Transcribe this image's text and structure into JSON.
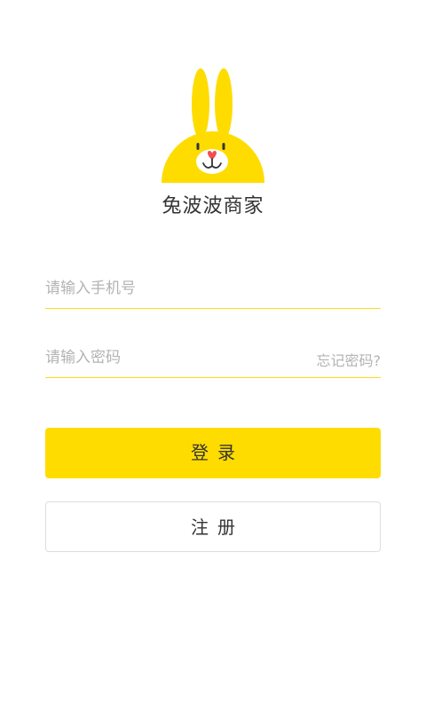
{
  "brand": {
    "app_name": "兔波波商家",
    "accent_color": "#FFDC00",
    "logo_icon": "rabbit-logo-icon"
  },
  "form": {
    "phone_placeholder": "请输入手机号",
    "phone_value": "",
    "password_placeholder": "请输入密码",
    "password_value": "",
    "forgot_password_label": "忘记密码?"
  },
  "actions": {
    "login_label": "登录",
    "register_label": "注册"
  }
}
